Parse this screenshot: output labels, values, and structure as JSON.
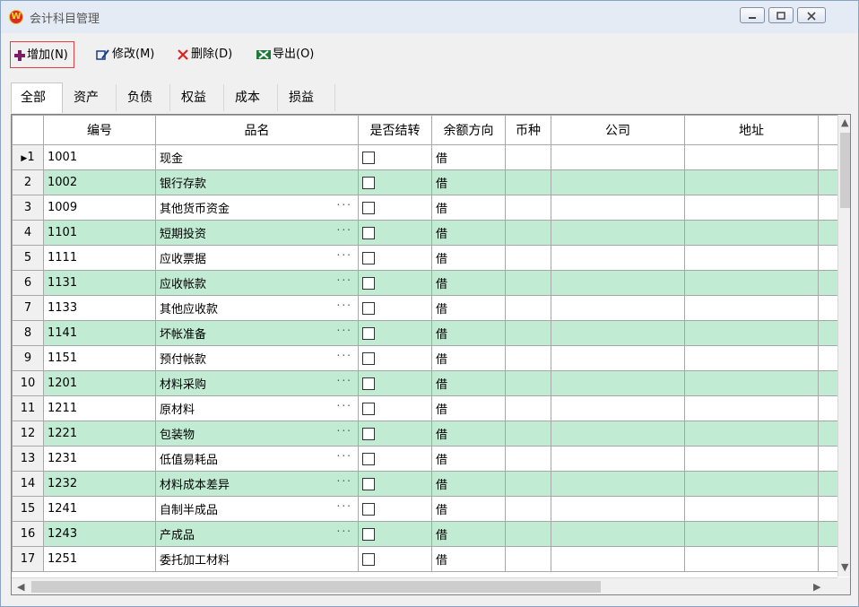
{
  "window": {
    "title": "会计科目管理",
    "icon": "app-logo-icon",
    "controls": [
      "minimize-icon",
      "maximize-icon",
      "close-icon"
    ]
  },
  "toolbar": {
    "add_label": "增加(N)",
    "edit_label": "修改(M)",
    "delete_label": "删除(D)",
    "export_label": "导出(O)"
  },
  "tabs": [
    {
      "label": "全部",
      "active": true
    },
    {
      "label": "资产"
    },
    {
      "label": "负债"
    },
    {
      "label": "权益"
    },
    {
      "label": "成本"
    },
    {
      "label": "损益"
    }
  ],
  "grid": {
    "columns": [
      "编号",
      "品名",
      "是否结转",
      "余额方向",
      "币种",
      "公司",
      "地址"
    ],
    "rows": [
      {
        "num": "1",
        "code": "1001",
        "name": "现金",
        "ellipsis": false,
        "dir": "借"
      },
      {
        "num": "2",
        "code": "1002",
        "name": "银行存款",
        "ellipsis": false,
        "dir": "借"
      },
      {
        "num": "3",
        "code": "1009",
        "name": "其他货币资金",
        "ellipsis": true,
        "dir": "借"
      },
      {
        "num": "4",
        "code": "1101",
        "name": "短期投资",
        "ellipsis": true,
        "dir": "借"
      },
      {
        "num": "5",
        "code": "1111",
        "name": "应收票据",
        "ellipsis": true,
        "dir": "借"
      },
      {
        "num": "6",
        "code": "1131",
        "name": "应收帐款",
        "ellipsis": true,
        "dir": "借"
      },
      {
        "num": "7",
        "code": "1133",
        "name": "其他应收款",
        "ellipsis": true,
        "dir": "借"
      },
      {
        "num": "8",
        "code": "1141",
        "name": "坏帐准备",
        "ellipsis": true,
        "dir": "借"
      },
      {
        "num": "9",
        "code": "1151",
        "name": "预付帐款",
        "ellipsis": true,
        "dir": "借"
      },
      {
        "num": "10",
        "code": "1201",
        "name": "材料采购",
        "ellipsis": true,
        "dir": "借"
      },
      {
        "num": "11",
        "code": "1211",
        "name": "原材料",
        "ellipsis": true,
        "dir": "借"
      },
      {
        "num": "12",
        "code": "1221",
        "name": "包装物",
        "ellipsis": true,
        "dir": "借"
      },
      {
        "num": "13",
        "code": "1231",
        "name": "低值易耗品",
        "ellipsis": true,
        "dir": "借"
      },
      {
        "num": "14",
        "code": "1232",
        "name": "材料成本差异",
        "ellipsis": true,
        "dir": "借"
      },
      {
        "num": "15",
        "code": "1241",
        "name": "自制半成品",
        "ellipsis": true,
        "dir": "借"
      },
      {
        "num": "16",
        "code": "1243",
        "name": "产成品",
        "ellipsis": true,
        "dir": "借"
      },
      {
        "num": "17",
        "code": "1251",
        "name": "委托加工材料",
        "ellipsis": false,
        "dir": "借"
      }
    ],
    "current_row_marker": "▶",
    "ellipsis_text": "...",
    "stripe_color": "#c1ebd3"
  },
  "scroll": {
    "up": "▲",
    "down": "▼",
    "left": "◀",
    "right": "▶"
  }
}
